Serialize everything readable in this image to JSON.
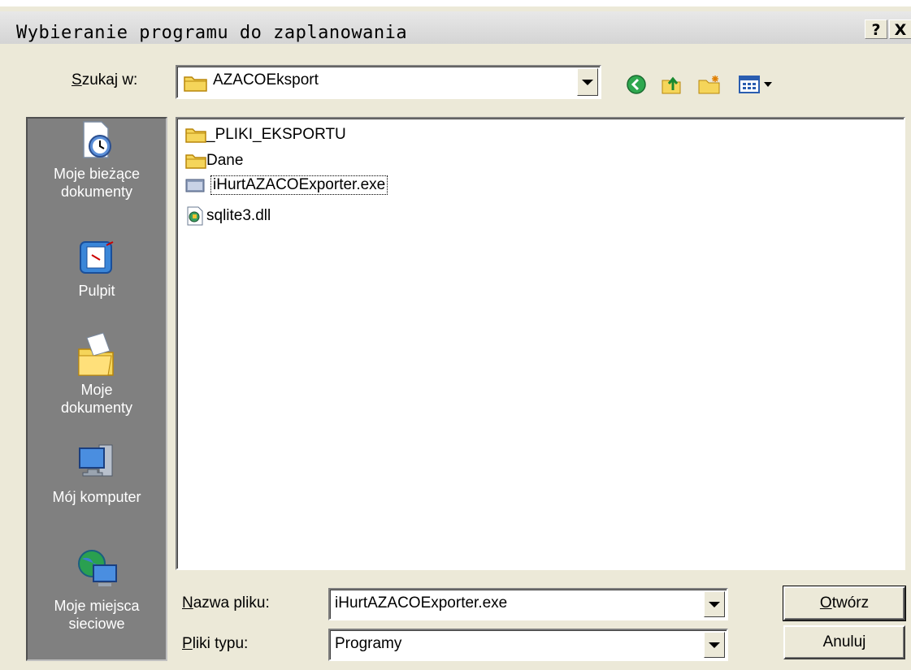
{
  "dialog": {
    "title": "Wybieranie programu do zaplanowania",
    "help_label": "?",
    "close_label": "X"
  },
  "lookin": {
    "label": "Szukaj w:",
    "mnemonic": "S",
    "rest": "zukaj w:",
    "value": "AZACOEksport"
  },
  "places": [
    {
      "label": "Moje bieżące dokumenty",
      "icon": "recent-documents-icon"
    },
    {
      "label": "Pulpit",
      "icon": "desktop-icon"
    },
    {
      "label": "Moje dokumenty",
      "icon": "my-documents-icon"
    },
    {
      "label": "Mój komputer",
      "icon": "my-computer-icon"
    },
    {
      "label": "Moje miejsca sieciowe",
      "icon": "network-places-icon"
    }
  ],
  "files": [
    {
      "name": "_PLIKI_EKSPORTU",
      "icon": "folder-icon"
    },
    {
      "name": "Dane",
      "icon": "folder-icon"
    },
    {
      "name": "iHurtAZACOExporter.exe",
      "icon": "exe-icon",
      "selected": true
    },
    {
      "name": "sqlite3.dll",
      "icon": "dll-icon"
    }
  ],
  "filename": {
    "mnemonic": "N",
    "rest": "azwa pliku:",
    "value": "iHurtAZACOExporter.exe"
  },
  "filetype": {
    "mnemonic": "P",
    "rest": "liki typu:",
    "value": "Programy"
  },
  "buttons": {
    "open_mnemonic": "O",
    "open_rest": "twórz",
    "cancel": "Anuluj"
  }
}
